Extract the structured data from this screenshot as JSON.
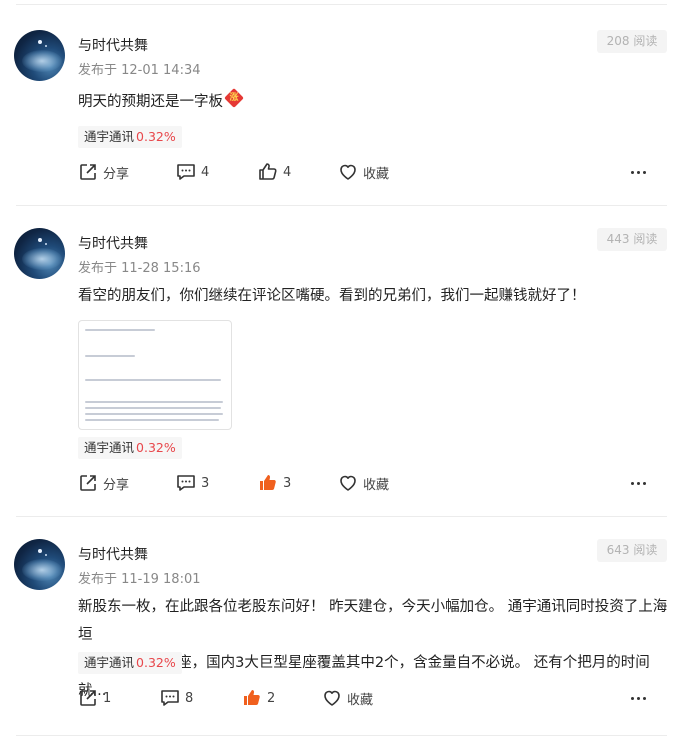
{
  "posts": [
    {
      "author": "与时代共舞",
      "published": "发布于 12-01 14:34",
      "reads": "208 阅读",
      "content": "明天的预期还是一字板",
      "badge_icon": "limit-up-badge-icon",
      "tag_name": "通宇通讯",
      "tag_pct": "0.32%",
      "share_label": "分享",
      "comment_count": "4",
      "like_count": "4",
      "like_active": false,
      "fav_label": "收藏"
    },
    {
      "author": "与时代共舞",
      "published": "发布于 11-28 15:16",
      "reads": "443 阅读",
      "content": "看空的朋友们，你们继续在评论区嘴硬。看到的兄弟们，我们一起赚钱就好了！",
      "has_image": true,
      "tag_name": "通宇通讯",
      "tag_pct": "0.32%",
      "share_label": "分享",
      "comment_count": "3",
      "like_count": "3",
      "like_active": true,
      "fav_label": "收藏"
    },
    {
      "author": "与时代共舞",
      "published": "发布于 11-19 18:01",
      "reads": "643 阅读",
      "content_line1": "新股东一枚，在此跟各位老股东问好！ 昨天建仓，今天小幅加仓。 通宇通讯同时投资了上海垣",
      "content_line2": "信星座+蓝箭星座，国内3大巨型星座覆盖其中2个，含金量自不必说。 还有个把月的时间就...",
      "tag_name": "通宇通讯",
      "tag_pct": "0.32%",
      "share_label": "1",
      "comment_count": "8",
      "like_count": "2",
      "like_active": true,
      "fav_label": "收藏"
    }
  ],
  "colors": {
    "accent_red": "#e8474b",
    "like_active": "#f0601e",
    "muted": "#888888"
  }
}
